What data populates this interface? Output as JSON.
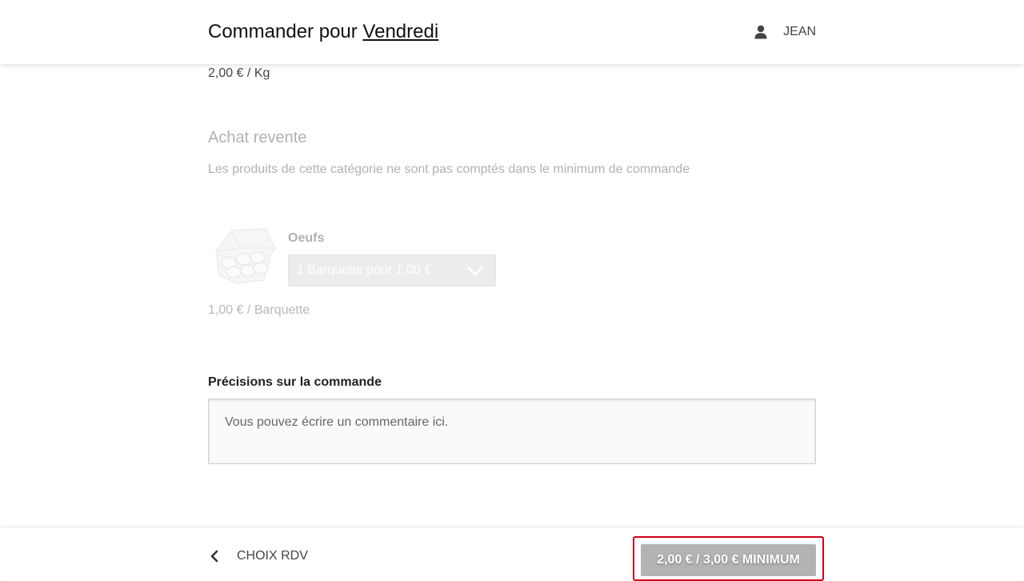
{
  "header": {
    "title_prefix": "Commander pour ",
    "day": "Vendredi",
    "user_name": "JEAN",
    "user_icon": "user-icon"
  },
  "previous_product": {
    "unit_price": "2,00 € / Kg"
  },
  "category": {
    "title": "Achat revente",
    "description": "Les produits de cette catégorie ne sont pas comptés dans le minimum de commande"
  },
  "product": {
    "name": "Oeufs",
    "image": "egg-carton",
    "selected_option": "1 Barquette pour 1,00 €",
    "unit_price": "1,00 € / Barquette"
  },
  "notes": {
    "label": "Précisions sur la commande",
    "placeholder": "Vous pouvez écrire un commentaire ici."
  },
  "footer": {
    "back_label": "CHOIX RDV",
    "submit_label": "2,00 € / 3,00 € MINIMUM"
  },
  "colors": {
    "highlight_border": "#d0021b",
    "submit_bg": "#b3b3b3",
    "select_bg": "#cfcfcf"
  }
}
